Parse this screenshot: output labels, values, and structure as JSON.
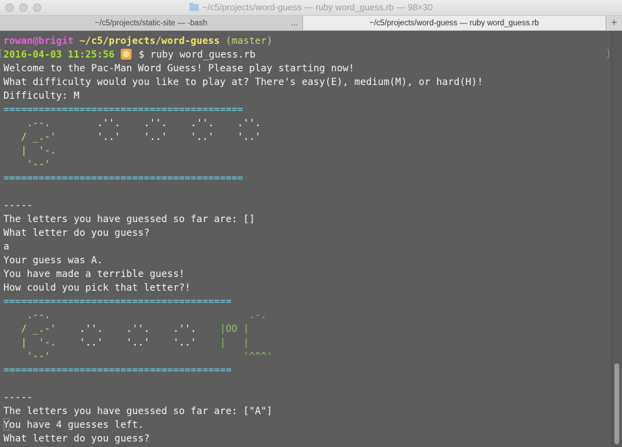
{
  "window": {
    "title": "~/c5/projects/word-guess — ruby word_guess.rb — 98×30"
  },
  "tabs": [
    {
      "label": "~/c5/projects/static-site — -bash",
      "more": "..."
    },
    {
      "label": "~/c5/projects/word-guess — ruby word_guess.rb"
    }
  ],
  "new_tab_label": "+",
  "prompt": {
    "user_host": "rowan@brigit",
    "path": "~/c5/projects/word-guess",
    "branch": "(master)",
    "datetime": "2016-04-03 11:25:56",
    "symbol": "$",
    "command": "ruby word_guess.rb"
  },
  "output": {
    "welcome": "Welcome to the Pac-Man Word Guess! Please play starting now!",
    "difficulty_question": "What difficulty would you like to play at? There's easy(E), medium(M), or hard(H)!",
    "difficulty_answer": "Difficulty: M",
    "board1": {
      "sep_top": "=========================================",
      "art": [
        {
          "pac": "    .--.     ",
          "dots": "   .''.    .''.    .''.    .''.",
          "ghost": ""
        },
        {
          "pac": "   / _.-'    ",
          "dots": "   '..'    '..'    '..'    '..'",
          "ghost": ""
        },
        {
          "pac": "   |  '-.    ",
          "dots": "",
          "ghost": ""
        },
        {
          "pac": "    '--'     ",
          "dots": "",
          "ghost": ""
        }
      ],
      "sep_bottom": "========================================="
    },
    "divider1": "-----",
    "guessed1": "The letters you have guessed so far are: []",
    "ask1": "What letter do you guess?",
    "input1": "a",
    "result1": "Your guess was A.",
    "feedback1": "You have made a terrible guess!",
    "feedback2": "How could you pick that letter?!",
    "board2": {
      "sep_top": "=======================================",
      "art": [
        {
          "pac": "    .--.     ",
          "dots": "",
          "ghost": "                             .-."
        },
        {
          "pac": "   / _.-'    ",
          "dots": ".''.    .''.    .''.  ",
          "ghost": "  |OO |"
        },
        {
          "pac": "   |  '-.    ",
          "dots": "'..'    '..'    '..'  ",
          "ghost": "  |   |"
        },
        {
          "pac": "    '--'     ",
          "dots": "",
          "ghost": "                            '^^^'"
        }
      ],
      "sep_bottom": "======================================="
    },
    "divider2": "-----",
    "guessed2": "The letters you have guessed so far are: [\"A\"]",
    "remaining": "You have 4 guesses left.",
    "ask2": "What letter do you guess?"
  }
}
